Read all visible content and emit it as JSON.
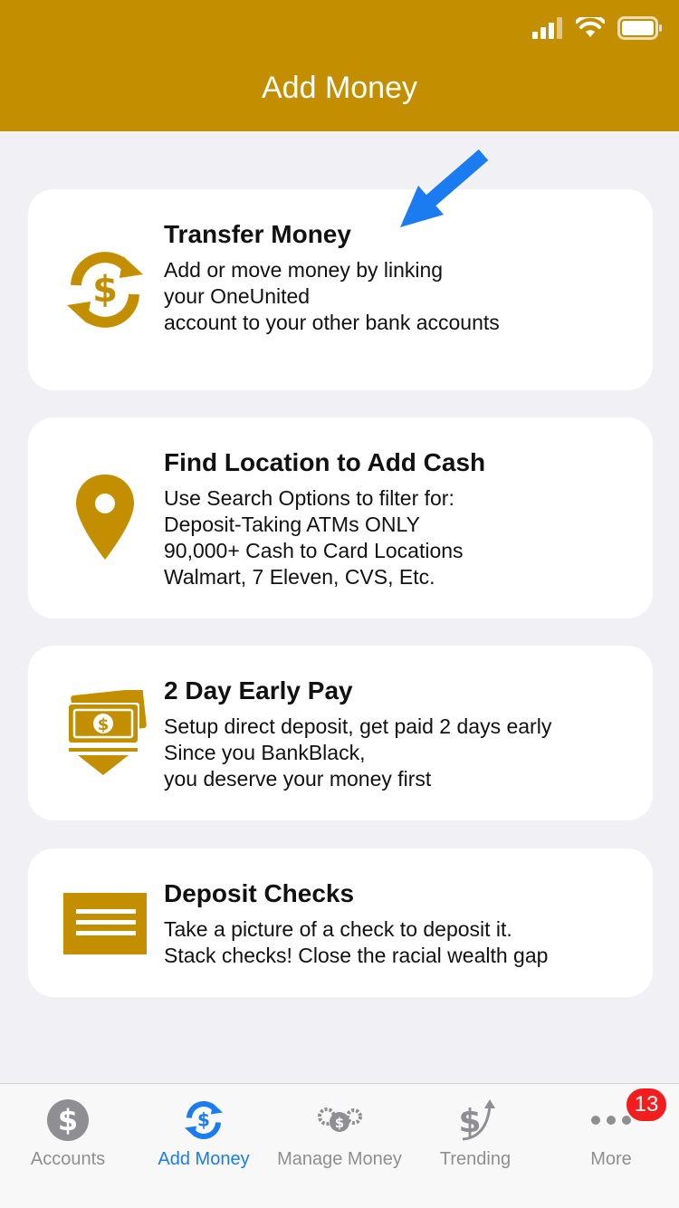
{
  "header": {
    "title": "Add Money"
  },
  "colors": {
    "brand": "#C38F00",
    "active_tab": "#1A7CF0",
    "inactive_tab": "#8E8E93",
    "badge": "#F21E1E",
    "arrow": "#1A7CF0"
  },
  "cards": [
    {
      "title": "Transfer Money",
      "icon": "dollar-cycle-icon",
      "lines": [
        "Add or move money by linking",
        "your OneUnited",
        "account to your other bank accounts"
      ]
    },
    {
      "title": "Find Location to Add Cash",
      "icon": "location-pin-icon",
      "lines": [
        "Use Search Options to filter for:",
        "Deposit-Taking ATMs ONLY",
        "90,000+ Cash to Card Locations",
        "Walmart, 7 Eleven, CVS, Etc."
      ]
    },
    {
      "title": "2 Day Early Pay",
      "icon": "cash-download-icon",
      "lines": [
        "Setup direct deposit, get paid 2 days early",
        "Since you BankBlack,",
        "you deserve your money first"
      ]
    },
    {
      "title": "Deposit Checks",
      "icon": "check-card-icon",
      "lines": [
        "Take a picture of a check to deposit it.",
        "Stack checks! Close the racial wealth gap"
      ]
    }
  ],
  "tabs": [
    {
      "label": "Accounts",
      "icon": "dollar-circle-icon"
    },
    {
      "label": "Add Money",
      "icon": "dollar-cycle-icon"
    },
    {
      "label": "Manage Money",
      "icon": "gears-icon"
    },
    {
      "label": "Trending",
      "icon": "dollar-trend-icon"
    },
    {
      "label": "More",
      "icon": "more-dots-icon"
    }
  ],
  "more_badge": "13"
}
